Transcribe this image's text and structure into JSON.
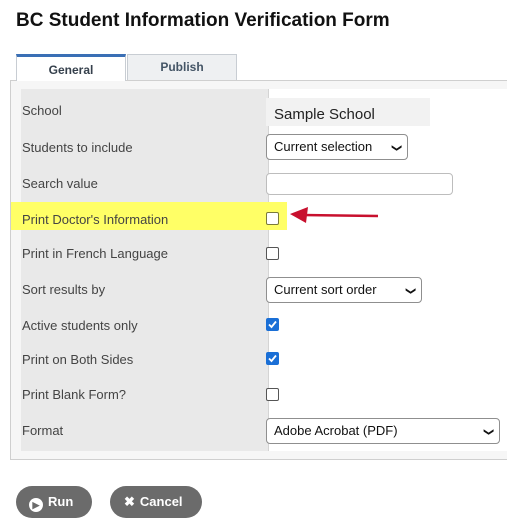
{
  "page": {
    "title": "BC Student Information Verification Form"
  },
  "tabs": [
    {
      "label": "General",
      "active": true
    },
    {
      "label": "Publish",
      "active": false
    }
  ],
  "form": {
    "school": {
      "label": "School",
      "value": "Sample School"
    },
    "students_to_include": {
      "label": "Students to include",
      "selected": "Current selection"
    },
    "search_value": {
      "label": "Search value",
      "value": ""
    },
    "print_doctors_info": {
      "label": "Print Doctor's Information",
      "checked": false,
      "highlighted": true,
      "highlight_color": "#ffff66"
    },
    "print_french": {
      "label": "Print in French Language",
      "checked": false
    },
    "sort_results_by": {
      "label": "Sort results by",
      "selected": "Current sort order"
    },
    "active_students_only": {
      "label": "Active students only",
      "checked": true
    },
    "print_both_sides": {
      "label": "Print on Both Sides",
      "checked": true
    },
    "print_blank_form": {
      "label": "Print Blank Form?",
      "checked": false
    },
    "format": {
      "label": "Format",
      "selected": "Adobe Acrobat (PDF)"
    }
  },
  "buttons": {
    "run": {
      "label": "Run",
      "icon": "play-circle-icon"
    },
    "cancel": {
      "label": "Cancel",
      "icon": "x-icon"
    }
  },
  "annotation": {
    "arrow_color": "#c8102e"
  }
}
